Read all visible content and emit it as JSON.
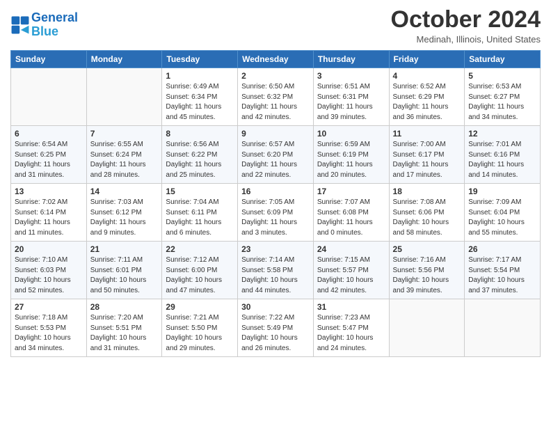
{
  "logo": {
    "name_general": "General",
    "name_blue": "Blue"
  },
  "header": {
    "month": "October 2024",
    "location": "Medinah, Illinois, United States"
  },
  "days_of_week": [
    "Sunday",
    "Monday",
    "Tuesday",
    "Wednesday",
    "Thursday",
    "Friday",
    "Saturday"
  ],
  "weeks": [
    [
      {
        "day": "",
        "sunrise": "",
        "sunset": "",
        "daylight": ""
      },
      {
        "day": "",
        "sunrise": "",
        "sunset": "",
        "daylight": ""
      },
      {
        "day": "1",
        "sunrise": "Sunrise: 6:49 AM",
        "sunset": "Sunset: 6:34 PM",
        "daylight": "Daylight: 11 hours and 45 minutes."
      },
      {
        "day": "2",
        "sunrise": "Sunrise: 6:50 AM",
        "sunset": "Sunset: 6:32 PM",
        "daylight": "Daylight: 11 hours and 42 minutes."
      },
      {
        "day": "3",
        "sunrise": "Sunrise: 6:51 AM",
        "sunset": "Sunset: 6:31 PM",
        "daylight": "Daylight: 11 hours and 39 minutes."
      },
      {
        "day": "4",
        "sunrise": "Sunrise: 6:52 AM",
        "sunset": "Sunset: 6:29 PM",
        "daylight": "Daylight: 11 hours and 36 minutes."
      },
      {
        "day": "5",
        "sunrise": "Sunrise: 6:53 AM",
        "sunset": "Sunset: 6:27 PM",
        "daylight": "Daylight: 11 hours and 34 minutes."
      }
    ],
    [
      {
        "day": "6",
        "sunrise": "Sunrise: 6:54 AM",
        "sunset": "Sunset: 6:25 PM",
        "daylight": "Daylight: 11 hours and 31 minutes."
      },
      {
        "day": "7",
        "sunrise": "Sunrise: 6:55 AM",
        "sunset": "Sunset: 6:24 PM",
        "daylight": "Daylight: 11 hours and 28 minutes."
      },
      {
        "day": "8",
        "sunrise": "Sunrise: 6:56 AM",
        "sunset": "Sunset: 6:22 PM",
        "daylight": "Daylight: 11 hours and 25 minutes."
      },
      {
        "day": "9",
        "sunrise": "Sunrise: 6:57 AM",
        "sunset": "Sunset: 6:20 PM",
        "daylight": "Daylight: 11 hours and 22 minutes."
      },
      {
        "day": "10",
        "sunrise": "Sunrise: 6:59 AM",
        "sunset": "Sunset: 6:19 PM",
        "daylight": "Daylight: 11 hours and 20 minutes."
      },
      {
        "day": "11",
        "sunrise": "Sunrise: 7:00 AM",
        "sunset": "Sunset: 6:17 PM",
        "daylight": "Daylight: 11 hours and 17 minutes."
      },
      {
        "day": "12",
        "sunrise": "Sunrise: 7:01 AM",
        "sunset": "Sunset: 6:16 PM",
        "daylight": "Daylight: 11 hours and 14 minutes."
      }
    ],
    [
      {
        "day": "13",
        "sunrise": "Sunrise: 7:02 AM",
        "sunset": "Sunset: 6:14 PM",
        "daylight": "Daylight: 11 hours and 11 minutes."
      },
      {
        "day": "14",
        "sunrise": "Sunrise: 7:03 AM",
        "sunset": "Sunset: 6:12 PM",
        "daylight": "Daylight: 11 hours and 9 minutes."
      },
      {
        "day": "15",
        "sunrise": "Sunrise: 7:04 AM",
        "sunset": "Sunset: 6:11 PM",
        "daylight": "Daylight: 11 hours and 6 minutes."
      },
      {
        "day": "16",
        "sunrise": "Sunrise: 7:05 AM",
        "sunset": "Sunset: 6:09 PM",
        "daylight": "Daylight: 11 hours and 3 minutes."
      },
      {
        "day": "17",
        "sunrise": "Sunrise: 7:07 AM",
        "sunset": "Sunset: 6:08 PM",
        "daylight": "Daylight: 11 hours and 0 minutes."
      },
      {
        "day": "18",
        "sunrise": "Sunrise: 7:08 AM",
        "sunset": "Sunset: 6:06 PM",
        "daylight": "Daylight: 10 hours and 58 minutes."
      },
      {
        "day": "19",
        "sunrise": "Sunrise: 7:09 AM",
        "sunset": "Sunset: 6:04 PM",
        "daylight": "Daylight: 10 hours and 55 minutes."
      }
    ],
    [
      {
        "day": "20",
        "sunrise": "Sunrise: 7:10 AM",
        "sunset": "Sunset: 6:03 PM",
        "daylight": "Daylight: 10 hours and 52 minutes."
      },
      {
        "day": "21",
        "sunrise": "Sunrise: 7:11 AM",
        "sunset": "Sunset: 6:01 PM",
        "daylight": "Daylight: 10 hours and 50 minutes."
      },
      {
        "day": "22",
        "sunrise": "Sunrise: 7:12 AM",
        "sunset": "Sunset: 6:00 PM",
        "daylight": "Daylight: 10 hours and 47 minutes."
      },
      {
        "day": "23",
        "sunrise": "Sunrise: 7:14 AM",
        "sunset": "Sunset: 5:58 PM",
        "daylight": "Daylight: 10 hours and 44 minutes."
      },
      {
        "day": "24",
        "sunrise": "Sunrise: 7:15 AM",
        "sunset": "Sunset: 5:57 PM",
        "daylight": "Daylight: 10 hours and 42 minutes."
      },
      {
        "day": "25",
        "sunrise": "Sunrise: 7:16 AM",
        "sunset": "Sunset: 5:56 PM",
        "daylight": "Daylight: 10 hours and 39 minutes."
      },
      {
        "day": "26",
        "sunrise": "Sunrise: 7:17 AM",
        "sunset": "Sunset: 5:54 PM",
        "daylight": "Daylight: 10 hours and 37 minutes."
      }
    ],
    [
      {
        "day": "27",
        "sunrise": "Sunrise: 7:18 AM",
        "sunset": "Sunset: 5:53 PM",
        "daylight": "Daylight: 10 hours and 34 minutes."
      },
      {
        "day": "28",
        "sunrise": "Sunrise: 7:20 AM",
        "sunset": "Sunset: 5:51 PM",
        "daylight": "Daylight: 10 hours and 31 minutes."
      },
      {
        "day": "29",
        "sunrise": "Sunrise: 7:21 AM",
        "sunset": "Sunset: 5:50 PM",
        "daylight": "Daylight: 10 hours and 29 minutes."
      },
      {
        "day": "30",
        "sunrise": "Sunrise: 7:22 AM",
        "sunset": "Sunset: 5:49 PM",
        "daylight": "Daylight: 10 hours and 26 minutes."
      },
      {
        "day": "31",
        "sunrise": "Sunrise: 7:23 AM",
        "sunset": "Sunset: 5:47 PM",
        "daylight": "Daylight: 10 hours and 24 minutes."
      },
      {
        "day": "",
        "sunrise": "",
        "sunset": "",
        "daylight": ""
      },
      {
        "day": "",
        "sunrise": "",
        "sunset": "",
        "daylight": ""
      }
    ]
  ]
}
